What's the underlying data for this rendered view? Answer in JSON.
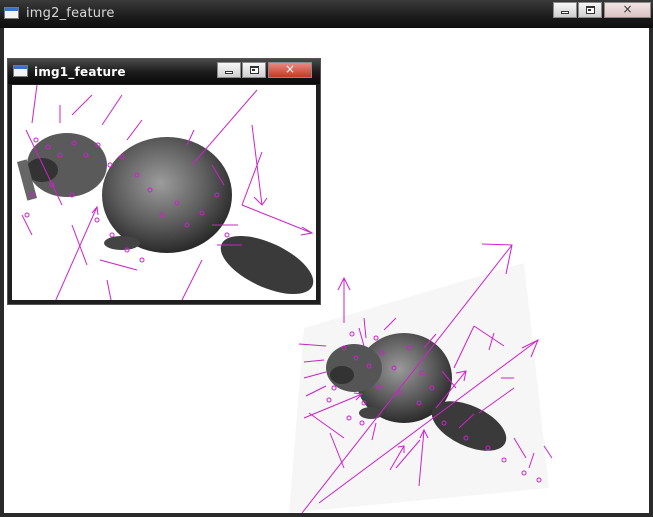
{
  "outer_window": {
    "title": "img2_feature",
    "buttons": {
      "minimize": "minimize",
      "maximize": "maximize",
      "close": "×"
    }
  },
  "inner_window": {
    "title": "img1_feature",
    "buttons": {
      "minimize": "minimize",
      "maximize": "maximize",
      "close": "×"
    }
  },
  "colors": {
    "keypoint": "#cc22cc",
    "frame_dark": "#1c1c1c",
    "close_red": "#d9534f"
  },
  "icons": [
    "window-app-icon",
    "minimize-icon",
    "maximize-icon",
    "close-icon"
  ]
}
